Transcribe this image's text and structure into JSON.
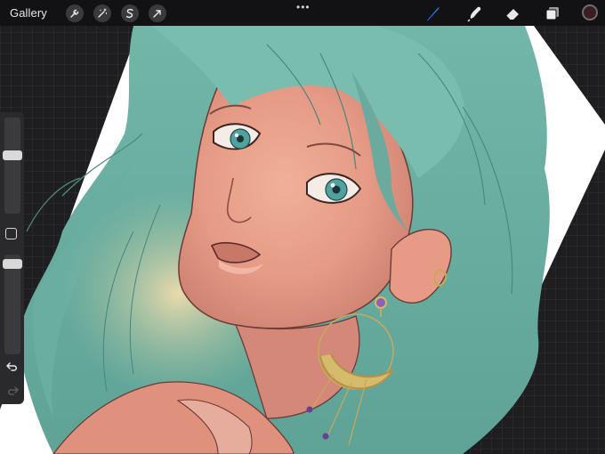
{
  "toolbar": {
    "gallery_label": "Gallery",
    "left_tools": [
      {
        "name": "actions",
        "icon": "wrench-icon"
      },
      {
        "name": "adjustments",
        "icon": "magic-wand-icon"
      },
      {
        "name": "selection",
        "icon": "selection-s-icon"
      },
      {
        "name": "transform",
        "icon": "arrow-cursor-icon"
      }
    ],
    "more_icon": "more-dots-icon",
    "more_glyph": "•••",
    "right_tools": [
      {
        "name": "brush",
        "icon": "brush-icon",
        "active": true
      },
      {
        "name": "smudge",
        "icon": "smudge-icon"
      },
      {
        "name": "eraser",
        "icon": "eraser-icon"
      },
      {
        "name": "layers",
        "icon": "layers-icon"
      }
    ],
    "current_color": "#3a1e22"
  },
  "sidebar": {
    "size_slider_level": 0.62,
    "opacity_slider_level": 0.95,
    "modify_icon": "square-modify-icon",
    "undo_icon": "undo-arrow-icon",
    "redo_icon": "redo-arrow-icon"
  },
  "colors": {
    "accent_active": "#2f7bf5",
    "hair": "#6fb1a5",
    "skin": "#e9a08a",
    "canvas_paper": "#ffffff"
  }
}
